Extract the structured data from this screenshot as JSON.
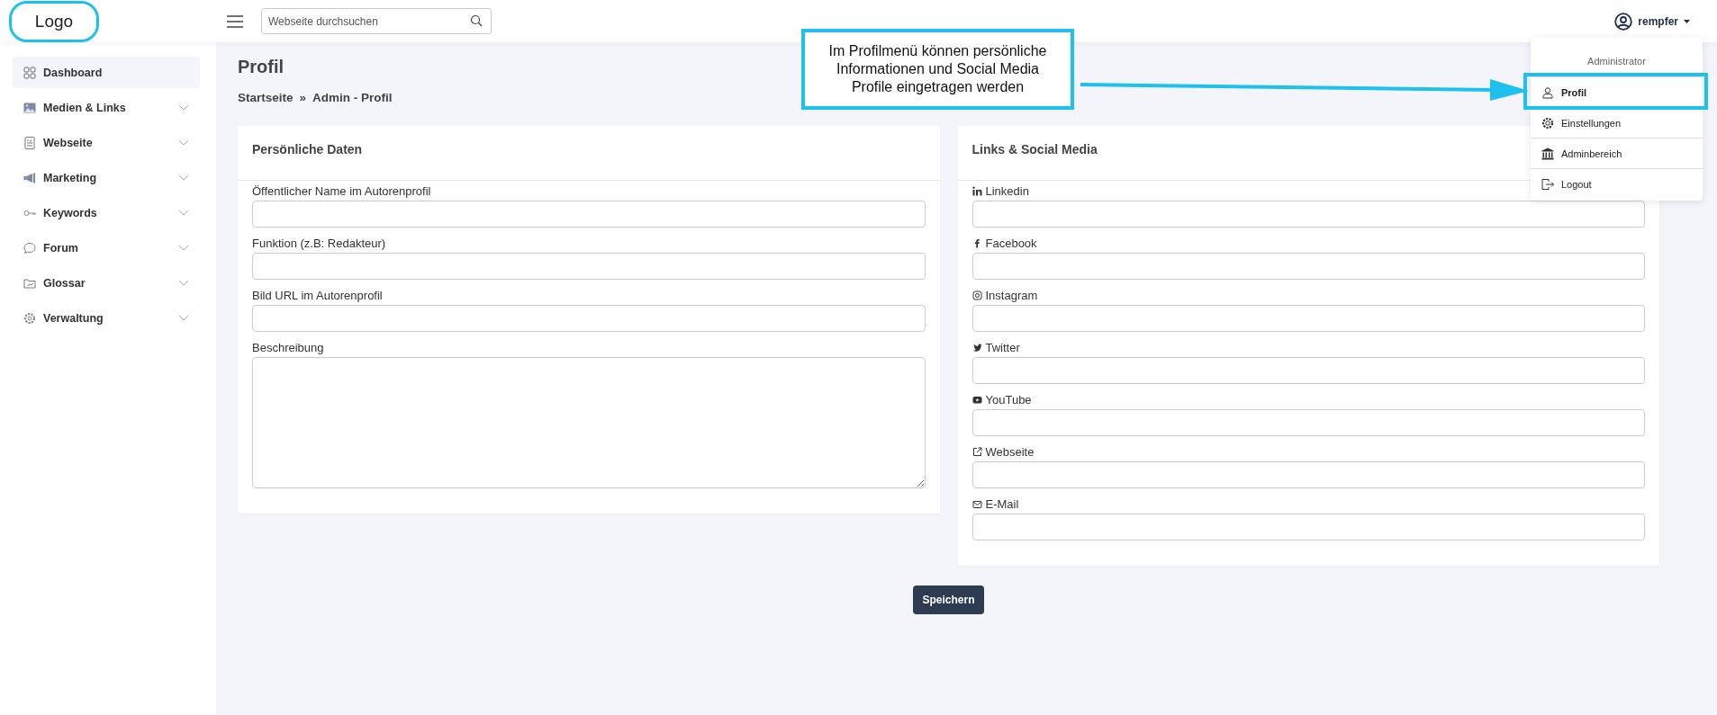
{
  "header": {
    "logo": "Logo",
    "search": {
      "placeholder": "Webseite durchsuchen"
    },
    "user": {
      "name": "rempfer"
    }
  },
  "sidebar": {
    "items": [
      {
        "label": "Dashboard",
        "selected": true
      },
      {
        "label": "Medien & Links",
        "selected": false,
        "expanded": false
      },
      {
        "label": "Webseite",
        "selected": false,
        "expanded": false
      },
      {
        "label": "Marketing",
        "selected": false,
        "expanded": false
      },
      {
        "label": "Keywords",
        "selected": false,
        "expanded": false
      },
      {
        "label": "Forum",
        "selected": false,
        "expanded": false
      },
      {
        "label": "Glossar",
        "selected": false,
        "expanded": false
      },
      {
        "label": "Verwaltung",
        "selected": false,
        "expanded": false
      }
    ]
  },
  "page": {
    "title": "Profil",
    "breadcrumb": [
      "Startseite",
      "Admin - Profil"
    ],
    "breadcrumb_separator": "»"
  },
  "cards": [
    {
      "title": "Persönliche Daten",
      "fields": [
        {
          "label": "Öffentlicher Name im Autorenprofil",
          "kind": "input"
        },
        {
          "label": "Funktion (z.B: Redakteur)",
          "kind": "input"
        },
        {
          "label": "Bild URL im Autorenprofil",
          "kind": "input"
        },
        {
          "label": "Beschreibung",
          "kind": "textarea"
        }
      ]
    },
    {
      "title": "Links & Social Media",
      "fields": [
        {
          "label": "Linkedin",
          "kind": "input"
        },
        {
          "label": "Facebook",
          "kind": "input"
        },
        {
          "label": "Instagram",
          "kind": "input"
        },
        {
          "label": "Twitter",
          "kind": "input"
        },
        {
          "label": "YouTube",
          "kind": "input"
        },
        {
          "label": "Webseite",
          "kind": "input"
        },
        {
          "label": "E-Mail",
          "kind": "input"
        }
      ]
    }
  ],
  "save_button": "Speichern",
  "user_menu": {
    "role": "Administrator",
    "items": [
      {
        "label": "Profil",
        "selected": true
      },
      {
        "label": "Einstellungen",
        "selected": false
      },
      {
        "label": "Adminbereich",
        "selected": false
      },
      {
        "label": "Logout",
        "selected": false
      }
    ]
  },
  "annotation": {
    "text": "Im Profilmenü können persönliche Informationen und Social Media Profile eingetragen werden"
  }
}
